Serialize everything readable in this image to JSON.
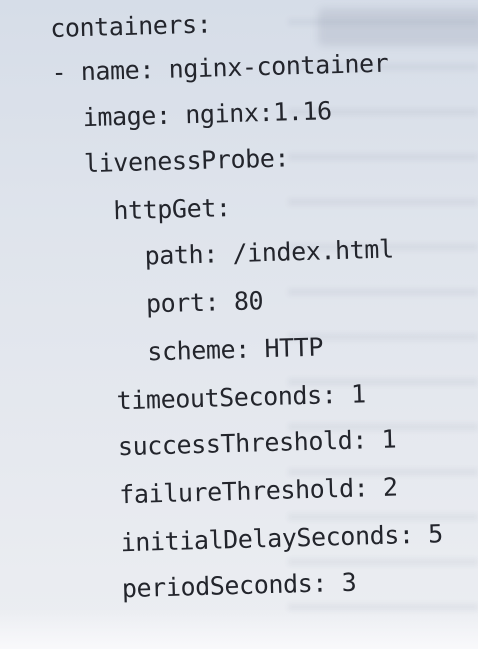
{
  "code_lines": [
    "containers:",
    "- name: nginx-container",
    "image: nginx:1.16",
    "livenessProbe:",
    "httpGet:",
    "path: /index.html",
    "port: 80",
    "scheme: HTTP",
    "timeoutSeconds: 1",
    "successThreshold: 1",
    "failureThreshold: 2",
    "initialDelaySeconds: 5",
    "periodSeconds: 3"
  ]
}
